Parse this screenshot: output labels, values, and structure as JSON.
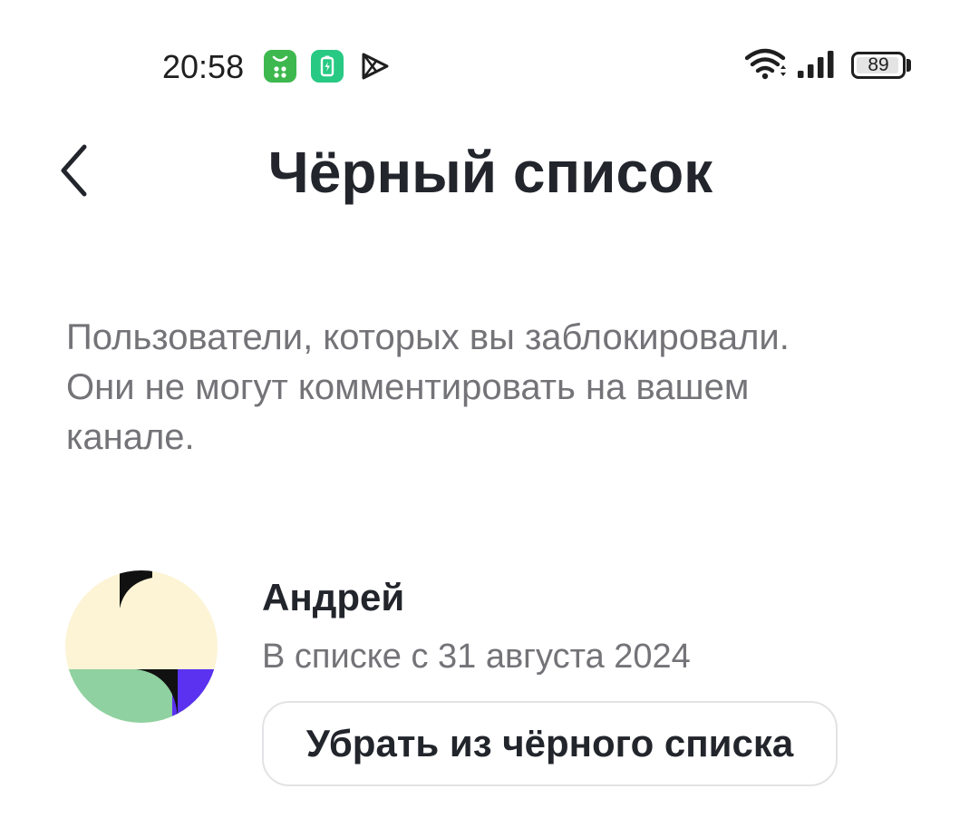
{
  "status_bar": {
    "time": "20:58",
    "icons": [
      "shop-app-icon",
      "battery-app-icon",
      "play-store-icon",
      "wifi-icon",
      "signal-icon"
    ],
    "battery_level": "89"
  },
  "header": {
    "back_icon": "chevron-left-icon",
    "title": "Чёрный список"
  },
  "description": {
    "line1": "Пользователи, которых вы заблокировали.",
    "line2": "Они не могут комментировать на вашем",
    "line3": "канале."
  },
  "blocked_users": [
    {
      "name": "Андрей",
      "since": "В списке с 31 августа 2024",
      "unblock_label": "Убрать из чёрного списка"
    }
  ],
  "colors": {
    "text_primary": "#22252b",
    "text_secondary": "#737378",
    "button_border": "#e3e3e6",
    "avatar_cream": "#fdf4d6",
    "avatar_green": "#8fd1a0",
    "avatar_purple": "#5a32f0"
  }
}
